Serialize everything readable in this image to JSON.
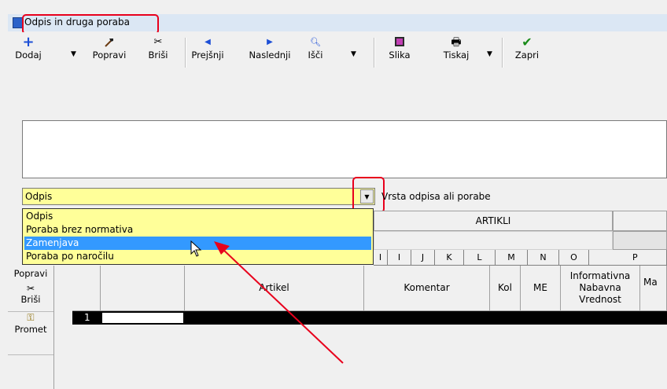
{
  "window": {
    "title": "Odpis in druga poraba"
  },
  "toolbar": {
    "add": "Dodaj",
    "edit": "Popravi",
    "delete": "Briši",
    "prev": "Prejšnji",
    "next": "Naslednji",
    "search": "Išči",
    "image": "Slika",
    "print": "Tiskaj",
    "close": "Zapri"
  },
  "combo": {
    "value": "Odpis",
    "label": "Vrsta odpisa ali porabe",
    "options": [
      "Odpis",
      "Poraba brez normativa",
      "Zamenjava",
      "Poraba po naročilu"
    ],
    "selected_index": 2
  },
  "grid": {
    "group_header": "ARTIKLI",
    "col_letters": [
      "I",
      "I",
      "J",
      "K",
      "L",
      "M",
      "N",
      "O",
      "P"
    ],
    "headers": {
      "artikel": "Artikel",
      "komentar": "Komentar",
      "kol": "Kol",
      "me": "ME",
      "info1": "Informativna",
      "info2": "Nabavna",
      "info3": "Vrednost",
      "partial": "Ma"
    },
    "row_number": "1"
  },
  "side": {
    "edit": "Popravi",
    "delete": "Briši",
    "promet": "Promet"
  },
  "colors": {
    "annotation": "#e8001c",
    "selection": "#3399ff",
    "field": "#ffff99"
  }
}
